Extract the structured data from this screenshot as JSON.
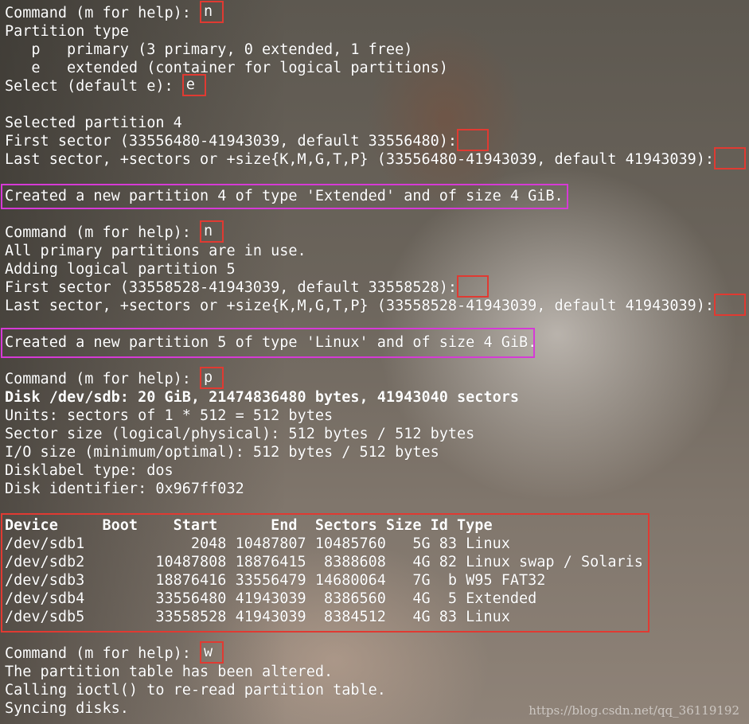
{
  "lines": [
    {
      "text": "Command (m for help): ",
      "input": "n"
    },
    {
      "text": "Partition type"
    },
    {
      "text": "   p   primary (3 primary, 0 extended, 1 free)"
    },
    {
      "text": "   e   extended (container for logical partitions)"
    },
    {
      "text": "Select (default e): ",
      "input": "e"
    },
    {
      "text": ""
    },
    {
      "text": "Selected partition 4"
    },
    {
      "text": "First sector (33556480-41943039, default 33556480):",
      "input": ""
    },
    {
      "text": "Last sector, +sectors or +size{K,M,G,T,P} (33556480-41943039, default 41943039):",
      "input": ""
    },
    {
      "text": ""
    },
    {
      "text": "Created a new partition 4 of type 'Extended' and of size 4 GiB."
    },
    {
      "text": ""
    },
    {
      "text": "Command (m for help): ",
      "input": "n"
    },
    {
      "text": "All primary partitions are in use."
    },
    {
      "text": "Adding logical partition 5"
    },
    {
      "text": "First sector (33558528-41943039, default 33558528):",
      "input": ""
    },
    {
      "text": "Last sector, +sectors or +size{K,M,G,T,P} (33558528-41943039, default 41943039):",
      "input": ""
    },
    {
      "text": ""
    },
    {
      "text": "Created a new partition 5 of type 'Linux' and of size 4 GiB."
    },
    {
      "text": ""
    },
    {
      "text": "Command (m for help): ",
      "input": "p"
    },
    {
      "text": "Disk /dev/sdb: 20 GiB, 21474836480 bytes, 41943040 sectors",
      "bold": true
    },
    {
      "text": "Units: sectors of 1 * 512 = 512 bytes"
    },
    {
      "text": "Sector size (logical/physical): 512 bytes / 512 bytes"
    },
    {
      "text": "I/O size (minimum/optimal): 512 bytes / 512 bytes"
    },
    {
      "text": "Disklabel type: dos"
    },
    {
      "text": "Disk identifier: 0x967ff032"
    },
    {
      "text": ""
    },
    {
      "text": "Device     Boot    Start      End  Sectors Size Id Type",
      "bold": true
    },
    {
      "text": "/dev/sdb1            2048 10487807 10485760   5G 83 Linux"
    },
    {
      "text": "/dev/sdb2        10487808 18876415  8388608   4G 82 Linux swap / Solaris"
    },
    {
      "text": "/dev/sdb3        18876416 33556479 14680064   7G  b W95 FAT32"
    },
    {
      "text": "/dev/sdb4        33556480 41943039  8386560   4G  5 Extended"
    },
    {
      "text": "/dev/sdb5        33558528 41943039  8384512   4G 83 Linux"
    },
    {
      "text": ""
    },
    {
      "text": "Command (m for help): ",
      "input": "w"
    },
    {
      "text": "The partition table has been altered."
    },
    {
      "text": "Calling ioctl() to re-read partition table."
    },
    {
      "text": "Syncing disks."
    }
  ],
  "watermark": "https://blog.csdn.net/qq_36119192",
  "colors": {
    "input_box": "#e03a32",
    "message_box": "#d63ad6",
    "text": "#ffffff"
  }
}
